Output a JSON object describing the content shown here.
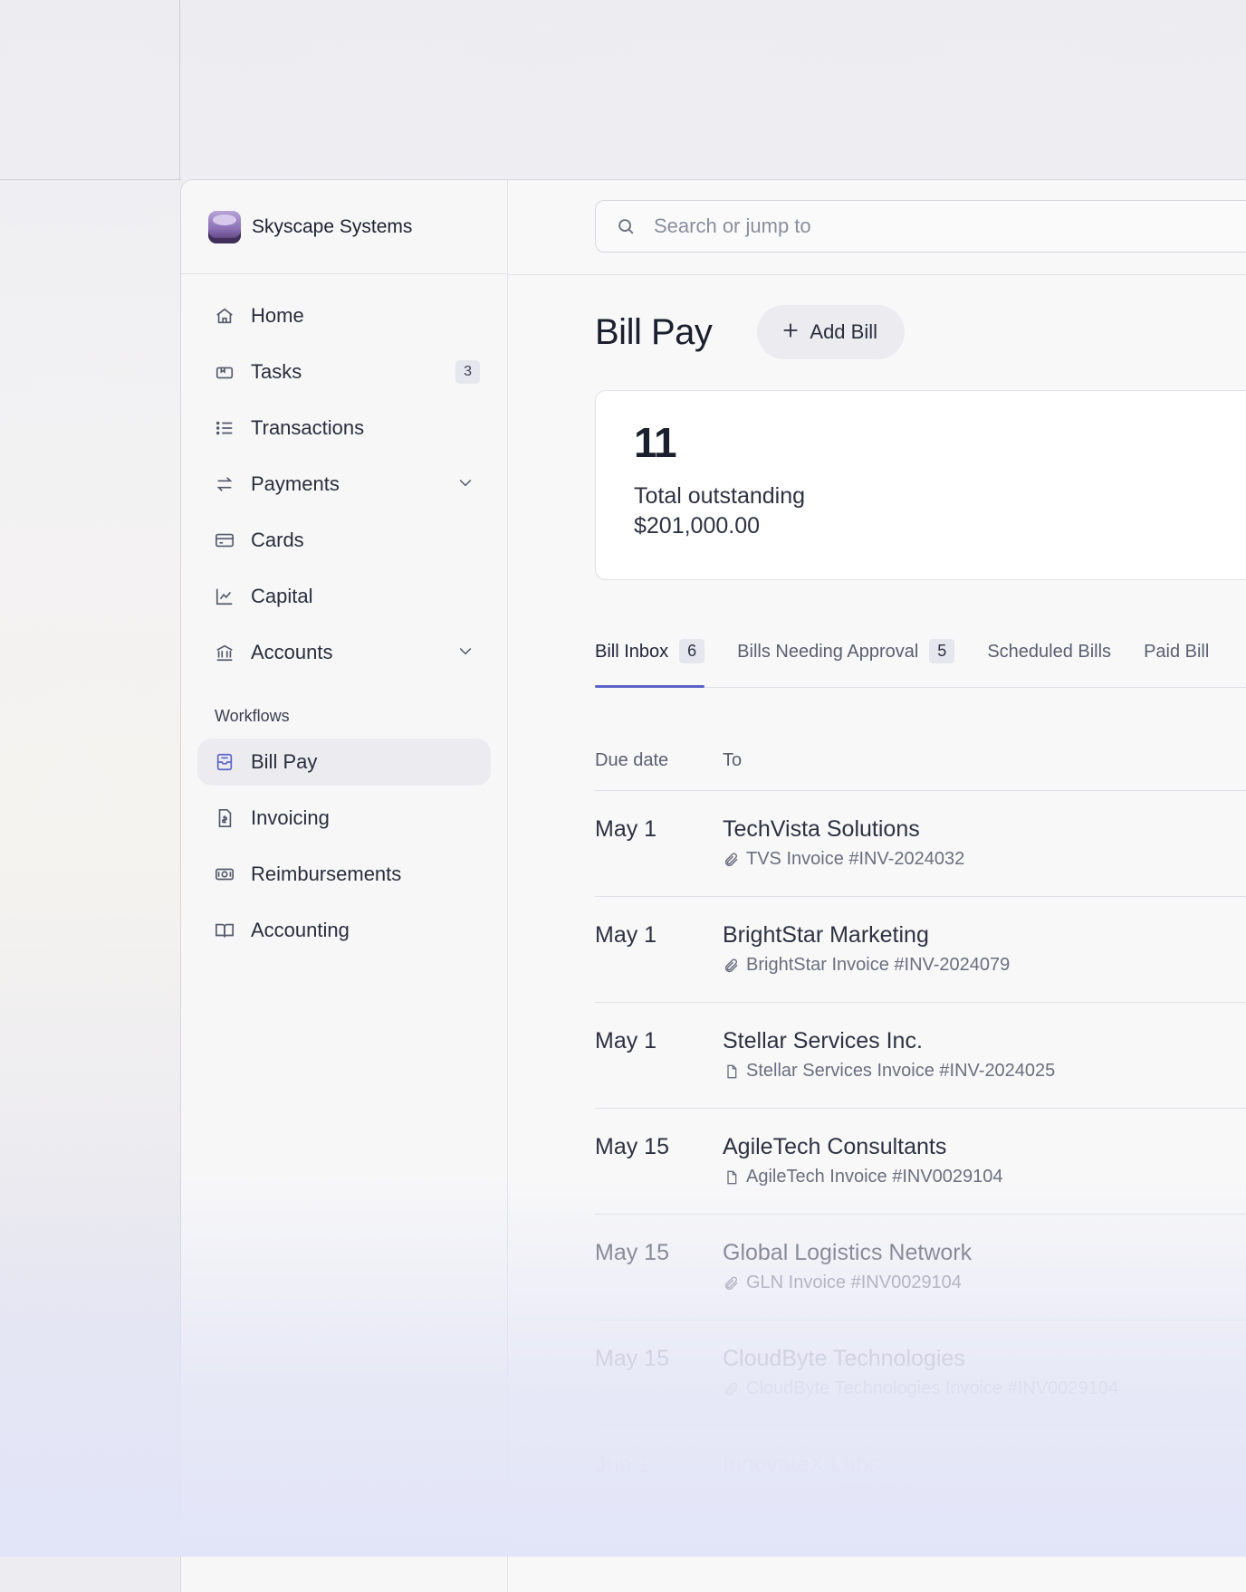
{
  "brand": {
    "name": "Skyscape Systems"
  },
  "search": {
    "placeholder": "Search or jump to"
  },
  "sidebar": {
    "items": [
      {
        "label": "Home",
        "icon": "home-icon"
      },
      {
        "label": "Tasks",
        "icon": "tasks-icon",
        "badge": "3"
      },
      {
        "label": "Transactions",
        "icon": "list-icon"
      },
      {
        "label": "Payments",
        "icon": "transfer-icon"
      },
      {
        "label": "Cards",
        "icon": "card-icon"
      },
      {
        "label": "Capital",
        "icon": "chart-icon"
      },
      {
        "label": "Accounts",
        "icon": "bank-icon"
      }
    ],
    "workflows_label": "Workflows",
    "workflows": [
      {
        "label": "Bill Pay",
        "icon": "bill-icon",
        "active": true
      },
      {
        "label": "Invoicing",
        "icon": "invoice-icon"
      },
      {
        "label": "Reimbursements",
        "icon": "cash-icon"
      },
      {
        "label": "Accounting",
        "icon": "book-icon"
      }
    ]
  },
  "page": {
    "title": "Bill Pay",
    "add_label": "Add Bill"
  },
  "summary": {
    "count": "11",
    "caption": "Total outstanding",
    "amount": "$201,000.00"
  },
  "tabs": [
    {
      "label": "Bill Inbox",
      "count": "6",
      "active": true
    },
    {
      "label": "Bills Needing Approval",
      "count": "5"
    },
    {
      "label": "Scheduled Bills"
    },
    {
      "label": "Paid Bill"
    }
  ],
  "table": {
    "headers": {
      "due": "Due date",
      "to": "To"
    },
    "rows": [
      {
        "due": "May 1",
        "to": "TechVista Solutions",
        "sub": "TVS Invoice #INV-2024032",
        "icon": "paperclip-icon"
      },
      {
        "due": "May 1",
        "to": "BrightStar Marketing",
        "sub": "BrightStar Invoice #INV-2024079",
        "icon": "paperclip-icon"
      },
      {
        "due": "May 1",
        "to": "Stellar Services Inc.",
        "sub": "Stellar Services Invoice #INV-2024025",
        "icon": "file-icon"
      },
      {
        "due": "May 15",
        "to": "AgileTech Consultants",
        "sub": "AgileTech Invoice #INV0029104",
        "icon": "file-icon"
      },
      {
        "due": "May 15",
        "to": "Global Logistics Network",
        "sub": "GLN Invoice #INV0029104",
        "icon": "paperclip-icon"
      },
      {
        "due": "May 15",
        "to": "CloudByte Technologies",
        "sub": "CloudByte Technologies Invoice #INV0029104",
        "icon": "paperclip-icon"
      },
      {
        "due": "Jun 1",
        "to": "InnovateX Labs",
        "sub": "INV0022104",
        "icon": "paperclip-icon"
      }
    ]
  },
  "colors": {
    "accent": "#5b63c9",
    "logo": "#8c6fb6"
  }
}
